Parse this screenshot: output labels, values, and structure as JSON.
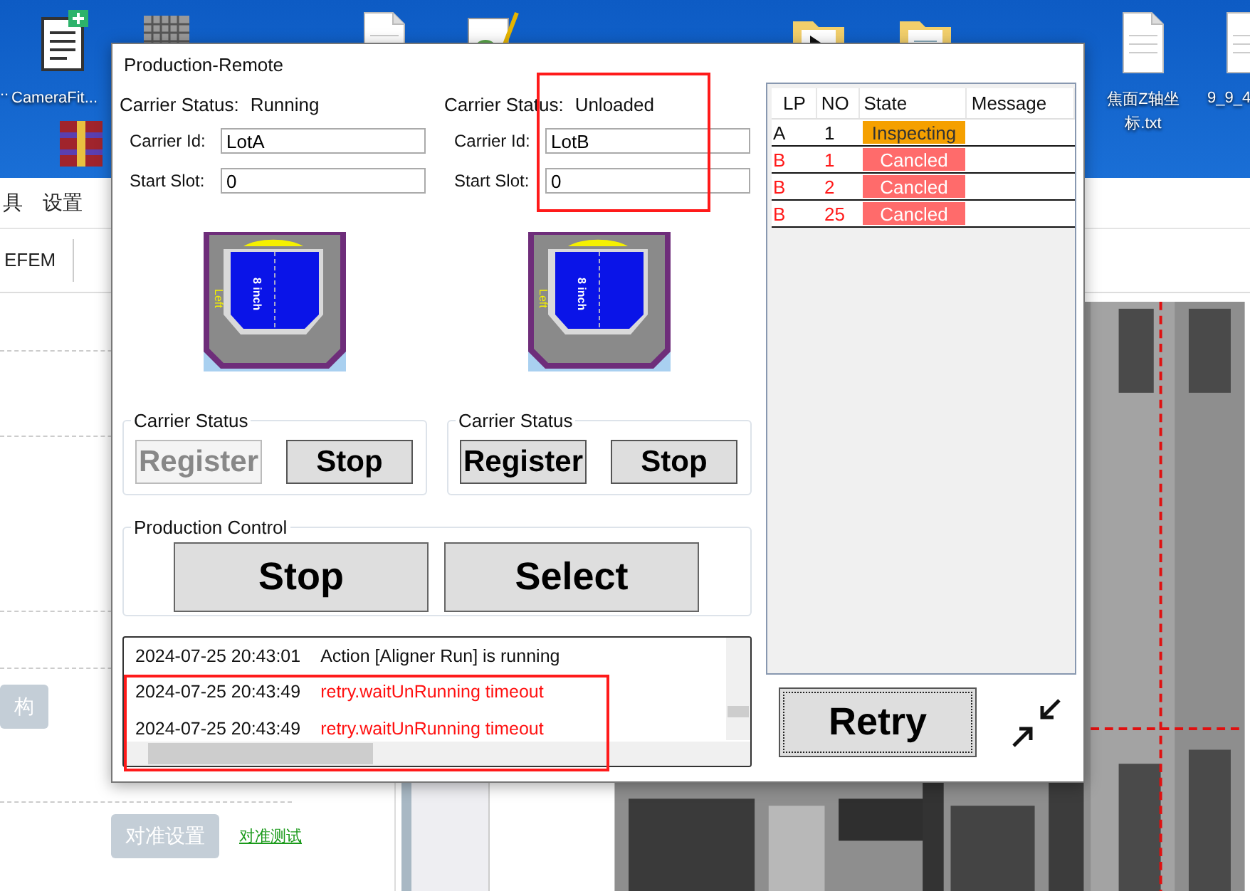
{
  "desktop": {
    "icons": [
      {
        "kind": "unknown",
        "label": ".."
      },
      {
        "kind": "csharp-file",
        "label": "CameraFit..."
      },
      {
        "kind": "binary-file"
      },
      {
        "kind": "document"
      },
      {
        "kind": "notepad"
      },
      {
        "kind": "video-folder"
      },
      {
        "kind": "folder"
      },
      {
        "kind": "archive"
      },
      {
        "kind": "document",
        "label": "焦面Z轴坐标.txt"
      },
      {
        "kind": "document",
        "label": "9_9_4"
      }
    ]
  },
  "app": {
    "menu": [
      "具",
      "设置"
    ],
    "toolbar": {
      "label": "EFEM"
    },
    "buttons": [
      "构",
      "对准设置"
    ],
    "link": "对准测试"
  },
  "dialog": {
    "title": "Production-Remote",
    "carriers": [
      {
        "status_label": "Carrier Status:",
        "status": "Running",
        "id_label": "Carrier Id:",
        "id": "LotA",
        "slot_label": "Start Slot:",
        "slot": "0",
        "wafer_size": "8 inch",
        "side": "Left",
        "group_title": "Carrier Status",
        "buttons": [
          {
            "label": "Register",
            "disabled": true
          },
          {
            "label": "Stop",
            "disabled": false
          }
        ]
      },
      {
        "status_label": "Carrier Status:",
        "status": "Unloaded",
        "id_label": "Carrier Id:",
        "id": "LotB",
        "slot_label": "Start Slot:",
        "slot": "0",
        "wafer_size": "8 inch",
        "side": "Left",
        "group_title": "Carrier Status",
        "buttons": [
          {
            "label": "Register",
            "disabled": false
          },
          {
            "label": "Stop",
            "disabled": false
          }
        ]
      }
    ],
    "production_control": {
      "title": "Production Control",
      "buttons": [
        "Stop",
        "Select"
      ]
    },
    "log": [
      {
        "time": "2024-07-25 20:43:01",
        "message": "Action [Aligner Run] is running",
        "kind": "info"
      },
      {
        "time": "2024-07-25 20:43:49",
        "message": "retry.waitUnRunning timeout",
        "kind": "error"
      },
      {
        "time": "2024-07-25 20:43:49",
        "message": "retry.waitUnRunning timeout",
        "kind": "error"
      }
    ],
    "table": {
      "columns": [
        "LP",
        "NO",
        "State",
        "Message"
      ],
      "rows": [
        {
          "lp": "A",
          "no": "1",
          "state": "Inspecting",
          "kind": "inspecting"
        },
        {
          "lp": "B",
          "no": "1",
          "state": "Cancled",
          "kind": "canceled"
        },
        {
          "lp": "B",
          "no": "2",
          "state": "Cancled",
          "kind": "canceled"
        },
        {
          "lp": "B",
          "no": "25",
          "state": "Cancled",
          "kind": "canceled"
        }
      ]
    },
    "retry_button": "Retry"
  }
}
